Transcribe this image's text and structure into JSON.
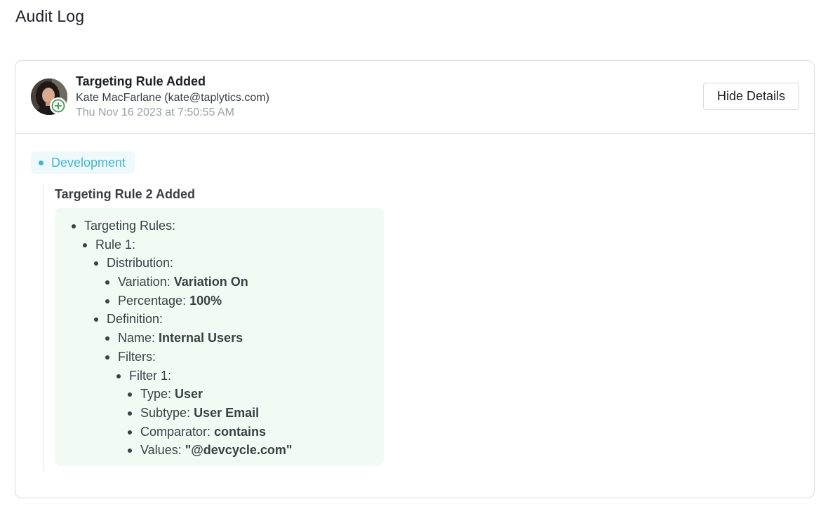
{
  "page": {
    "title": "Audit Log"
  },
  "entry": {
    "title": "Targeting Rule Added",
    "user": "Kate MacFarlane (kate@taplytics.com)",
    "timestamp": "Thu Nov 16 2023 at 7:50:55 AM",
    "hide_details_label": "Hide Details",
    "environment": "Development",
    "change_title": "Targeting Rule 2 Added",
    "tree": [
      {
        "key": "Targeting Rules:",
        "val": ""
      },
      {
        "key": "Rule 1:",
        "val": ""
      },
      {
        "key": "Distribution:",
        "val": ""
      },
      {
        "key": "Variation: ",
        "val": "Variation On"
      },
      {
        "key": "Percentage: ",
        "val": "100%"
      },
      {
        "key": "Definition:",
        "val": ""
      },
      {
        "key": "Name: ",
        "val": "Internal Users"
      },
      {
        "key": "Filters:",
        "val": ""
      },
      {
        "key": "Filter 1:",
        "val": ""
      },
      {
        "key": "Type: ",
        "val": "User"
      },
      {
        "key": "Subtype: ",
        "val": "User Email"
      },
      {
        "key": "Comparator: ",
        "val": "contains"
      },
      {
        "key": "Values: ",
        "val": "\"@devcycle.com\""
      }
    ]
  },
  "colors": {
    "environment_accent": "#47b4cc",
    "added_green": "#3e9a4e",
    "diff_background": "#f1fbf3"
  },
  "icons": {
    "avatar": "user-avatar-photo",
    "badge": "plus-circle-icon"
  }
}
